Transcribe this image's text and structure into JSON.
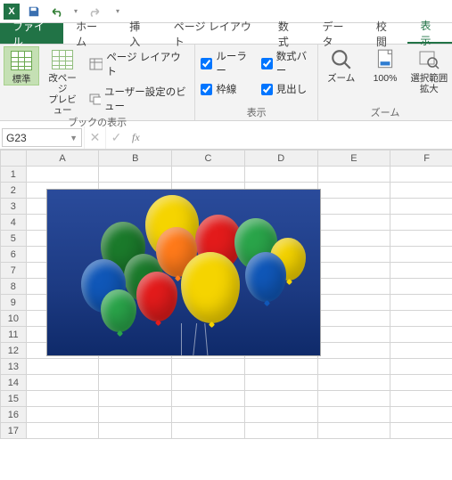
{
  "qat": {
    "app_letter": "X",
    "save_icon": "save-icon",
    "undo_icon": "undo-icon",
    "redo_icon": "redo-icon"
  },
  "tabs": {
    "file": "ファイル",
    "items": [
      {
        "label": "ホーム"
      },
      {
        "label": "挿入"
      },
      {
        "label": "ページ レイアウト"
      },
      {
        "label": "数式"
      },
      {
        "label": "データ"
      },
      {
        "label": "校閲"
      },
      {
        "label": "表示"
      }
    ],
    "active_index": 6
  },
  "ribbon": {
    "views": {
      "normal": "標準",
      "page_break": "改ページ\nプレビュー",
      "page_layout": "ページ レイアウト",
      "custom_views": "ユーザー設定のビュー",
      "group_label": "ブックの表示"
    },
    "show": {
      "ruler": "ルーラー",
      "formula_bar": "数式バー",
      "gridlines": "枠線",
      "headings": "見出し",
      "group_label": "表示",
      "ruler_checked": true,
      "formula_bar_checked": true,
      "gridlines_checked": true,
      "headings_checked": true
    },
    "zoom": {
      "zoom": "ズーム",
      "hundred": "100%",
      "selection": "選択範囲\n拡大",
      "group_label": "ズーム"
    }
  },
  "formula_bar": {
    "name_box": "G23",
    "fx": "fx",
    "cancel": "✕",
    "enter": "✓",
    "value": ""
  },
  "grid": {
    "columns": [
      "A",
      "B",
      "C",
      "D",
      "E",
      "F"
    ],
    "rows": [
      1,
      2,
      3,
      4,
      5,
      6,
      7,
      8,
      9,
      10,
      11,
      12,
      13,
      14,
      15,
      16,
      17
    ]
  },
  "embedded_image": {
    "description": "balloons-photo"
  }
}
